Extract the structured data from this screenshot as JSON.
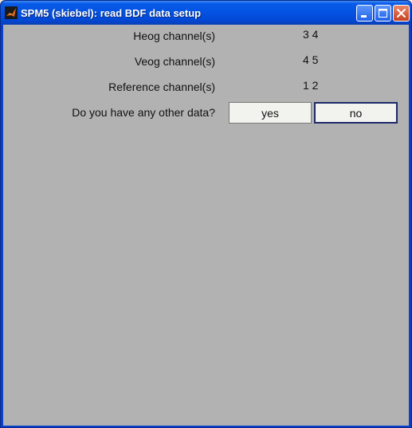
{
  "window": {
    "title": "SPM5 (skiebel): read BDF data setup",
    "buttons": {
      "minimize": "minimize-icon",
      "maximize": "maximize-icon",
      "close": "close-icon"
    }
  },
  "form": {
    "rows": [
      {
        "label": "Heog channel(s)",
        "value": "3 4"
      },
      {
        "label": "Veog channel(s)",
        "value": "4 5"
      },
      {
        "label": "Reference channel(s)",
        "value": "1 2"
      }
    ],
    "question": "Do you have any other data?",
    "yes_label": "yes",
    "no_label": "no"
  },
  "colors": {
    "client_background": "#b2b2b2",
    "titlebar": "#0454e3"
  }
}
